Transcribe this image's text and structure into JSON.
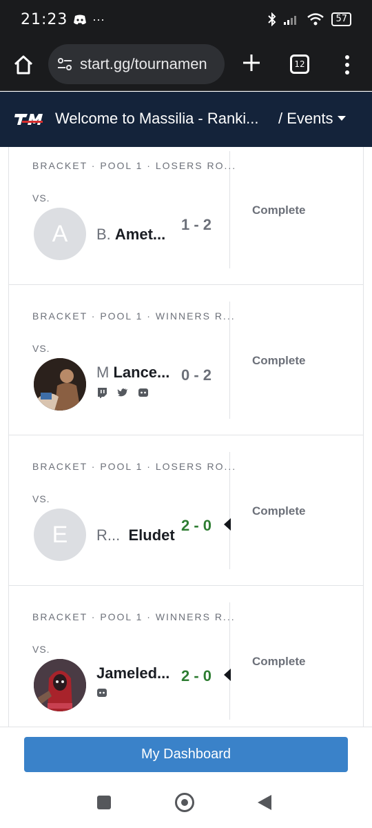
{
  "status_bar": {
    "time": "21:23",
    "dots": "···",
    "battery": "57"
  },
  "browser": {
    "url": "start.gg/tournamen",
    "tab_count": "12"
  },
  "site_header": {
    "title": "Welcome to Massilia - Ranki...",
    "events_label": "/ Events"
  },
  "sets": [
    {
      "round": "BRACKET · POOL 1 · LOSERS RO...",
      "vs": "VS.",
      "avatar_letter": "A",
      "prefix": "B.",
      "gamertag": "Amet...",
      "score": "1 - 2",
      "status": "Complete"
    },
    {
      "round": "BRACKET · POOL 1 · WINNERS R...",
      "vs": "VS.",
      "avatar_letter": "",
      "prefix": "M",
      "gamertag": "Lance...",
      "score": "0 - 2",
      "status": "Complete"
    },
    {
      "round": "BRACKET · POOL 1 · LOSERS RO...",
      "vs": "VS.",
      "avatar_letter": "E",
      "prefix": "R...",
      "gamertag": "Eludet",
      "score": "2 - 0",
      "status": "Complete"
    },
    {
      "round": "BRACKET · POOL 1 · WINNERS R...",
      "vs": "VS.",
      "avatar_letter": "",
      "prefix": "",
      "gamertag": "Jameled...",
      "score": "2 - 0",
      "status": "Complete"
    }
  ],
  "dashboard": {
    "label": "My Dashboard"
  },
  "colors": {
    "site_header_bg": "#14233a",
    "win_score": "#2e7d32",
    "dashboard_button": "#3a82c9"
  }
}
